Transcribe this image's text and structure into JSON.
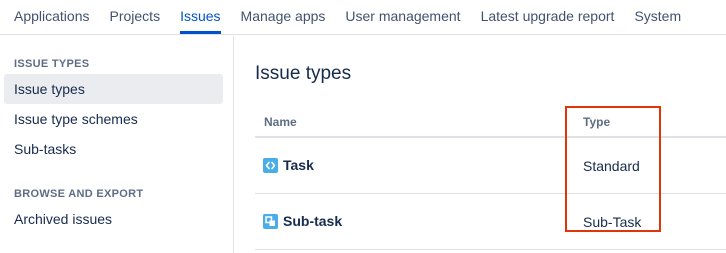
{
  "topnav": {
    "tabs": [
      {
        "label": "Applications"
      },
      {
        "label": "Projects"
      },
      {
        "label": "Issues"
      },
      {
        "label": "Manage apps"
      },
      {
        "label": "User management"
      },
      {
        "label": "Latest upgrade report"
      },
      {
        "label": "System"
      }
    ],
    "active_tab": "Issues"
  },
  "sidebar": {
    "sections": [
      {
        "heading": "ISSUE TYPES",
        "items": [
          {
            "label": "Issue types",
            "selected": true
          },
          {
            "label": "Issue type schemes"
          },
          {
            "label": "Sub-tasks"
          }
        ]
      },
      {
        "heading": "BROWSE AND EXPORT",
        "items": [
          {
            "label": "Archived issues"
          }
        ]
      }
    ]
  },
  "main": {
    "title": "Issue types",
    "columns": {
      "name": "Name",
      "type": "Type"
    },
    "rows": [
      {
        "name": "Task",
        "type": "Standard",
        "icon": "task-icon"
      },
      {
        "name": "Sub-task",
        "type": "Sub-Task",
        "icon": "subtask-icon"
      }
    ]
  },
  "colors": {
    "accent": "#0052cc",
    "icon_blue": "#4bade8",
    "highlight": "#de350b",
    "selected_bg": "#ebecf0"
  }
}
